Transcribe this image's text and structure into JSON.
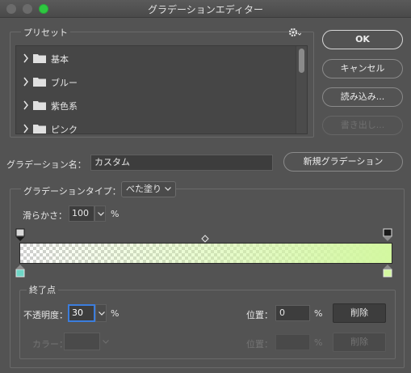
{
  "window": {
    "title": "グラデーションエディター"
  },
  "presets": {
    "legend": "プリセット",
    "items": [
      {
        "label": "基本"
      },
      {
        "label": "ブルー"
      },
      {
        "label": "紫色系"
      },
      {
        "label": "ピンク"
      }
    ]
  },
  "buttons": {
    "ok": "OK",
    "cancel": "キャンセル",
    "load": "読み込み...",
    "export": "書き出し..."
  },
  "name": {
    "label": "グラデーション名：",
    "value": "カスタム",
    "new_button": "新規グラデーション"
  },
  "gradient": {
    "type_label": "グラデーションタイプ：",
    "type_value": "べた塗り",
    "smoothness_label": "滑らかさ：",
    "smoothness_value": "100",
    "smoothness_unit": "%",
    "end_color": "#d3f8a0",
    "left_color_stop": "#6fd6c6",
    "right_color_stop": "#d3f8a0"
  },
  "stops": {
    "legend": "終了点",
    "opacity_label": "不透明度：",
    "opacity_value": "30",
    "opacity_unit": "%",
    "location_label": "位置：",
    "location_value": "0",
    "location_unit": "%",
    "delete_label": "削除",
    "color_label": "カラー：",
    "color_location_label": "位置：",
    "color_location_unit": "%",
    "color_delete_label": "削除"
  }
}
